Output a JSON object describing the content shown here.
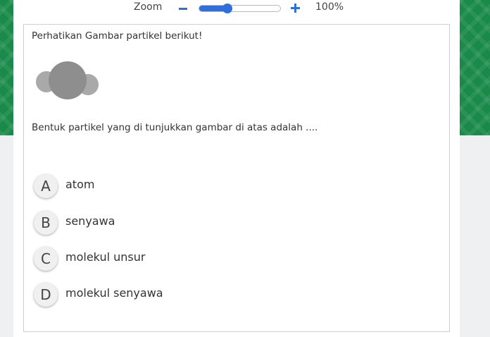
{
  "zoom": {
    "label": "Zoom",
    "value_text": "100%",
    "slider_level": 0.35
  },
  "question": {
    "prompt": "Perhatikan Gambar partikel berikut!",
    "text": "Bentuk partikel yang di tunjukkan gambar di atas adalah ....",
    "options": [
      {
        "letter": "A",
        "text": "atom"
      },
      {
        "letter": "B",
        "text": "senyawa"
      },
      {
        "letter": "C",
        "text": "molekul unsur"
      },
      {
        "letter": "D",
        "text": "molekul senyawa"
      }
    ]
  },
  "colors": {
    "background_green": "#1a8a4a",
    "accent_blue": "#2d6fdc",
    "particle_large": "#8e8e8e",
    "particle_small": "#a9a9a9"
  }
}
